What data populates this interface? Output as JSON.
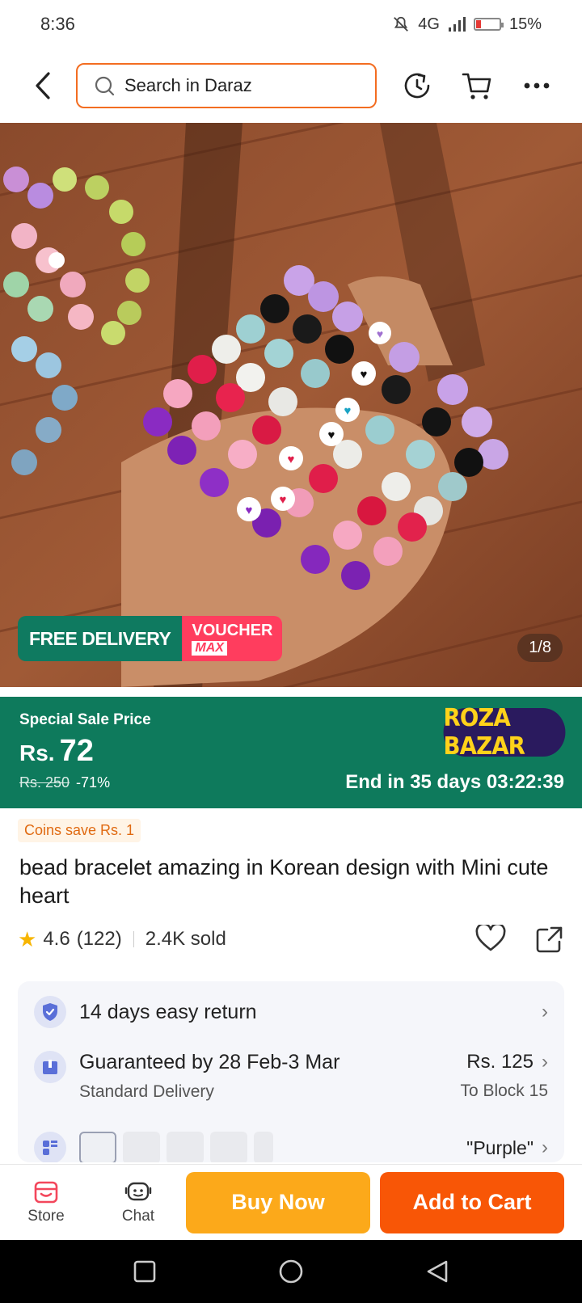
{
  "status": {
    "time": "8:36",
    "network": "4G",
    "battery": "15%"
  },
  "header": {
    "search_placeholder": "Search in Daraz"
  },
  "hero": {
    "image_counter": "1/8",
    "promo_free": "FREE DELIVERY",
    "promo_voucher": "VOUCHER",
    "promo_max": "MAX"
  },
  "sale": {
    "label": "Special Sale Price",
    "currency": "Rs.",
    "price": "72",
    "original_price": "Rs. 250",
    "discount": "-71%",
    "store_logo": "ROZA BAZAR",
    "end_text": "End in 35 days 03:22:39"
  },
  "coins": "Coins save Rs. 1",
  "product": {
    "title": "bead bracelet amazing in Korean design with Mini cute heart",
    "rating": "4.6",
    "reviews": "(122)",
    "sold": "2.4K sold"
  },
  "services": {
    "returns": "14 days easy return",
    "delivery_title": "Guaranteed by 28 Feb-3 Mar",
    "delivery_type": "Standard Delivery",
    "delivery_price": "Rs. 125",
    "delivery_location": "To Block 15",
    "variant": "\"Purple\""
  },
  "bottom": {
    "store": "Store",
    "chat": "Chat",
    "buy_now": "Buy Now",
    "add_to_cart": "Add to Cart"
  },
  "colors": {
    "brand_orange": "#f85606",
    "buy_yellow": "#fca91a",
    "sale_green": "#0e7a5c"
  }
}
